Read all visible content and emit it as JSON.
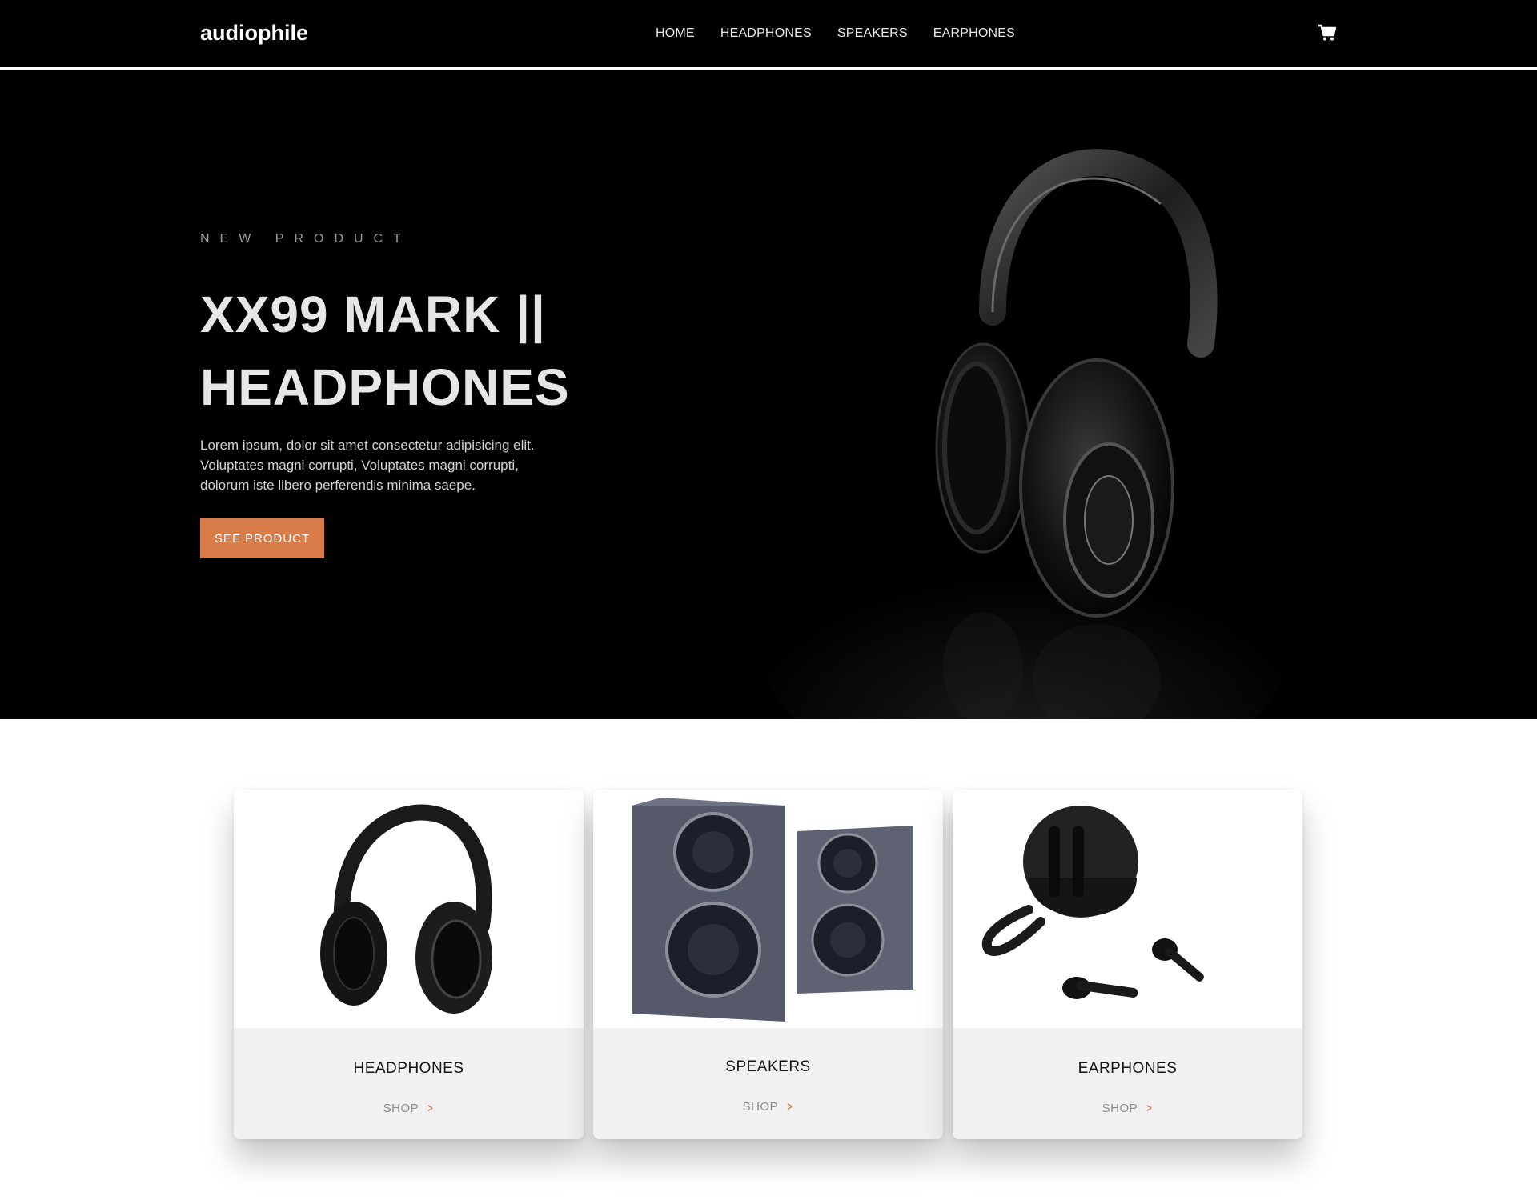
{
  "nav": {
    "logo": "audiophile",
    "links": [
      "HOME",
      "HEADPHONES",
      "SPEAKERS",
      "EARPHONES"
    ],
    "cart_icon": "cart-icon"
  },
  "hero": {
    "overline": "NEW PRODUCT",
    "title": "XX99 MARK || HEADPHONES",
    "description": "Lorem ipsum, dolor sit amet consectetur adipisicing elit. Voluptates magni corrupti, Voluptates magni corrupti, dolorum iste libero perferendis minima saepe.",
    "button_label": "SEE PRODUCT",
    "image_icon": "headphones-hero-image"
  },
  "categories": [
    {
      "name": "HEADPHONES",
      "link": "SHOP",
      "icon": "headphones-image"
    },
    {
      "name": "SPEAKERS",
      "link": "SHOP",
      "icon": "speakers-image"
    },
    {
      "name": "EARPHONES",
      "link": "SHOP",
      "icon": "earphones-image"
    }
  ],
  "colors": {
    "accent": "#d87d4a",
    "dark": "#000000",
    "light_gray": "#f1f1f1"
  }
}
